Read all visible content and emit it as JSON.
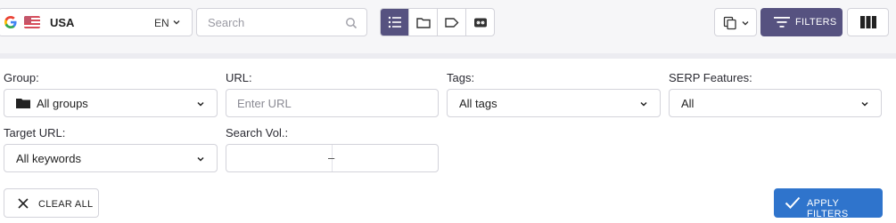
{
  "topbar": {
    "country": "USA",
    "language": "EN",
    "search_placeholder": "Search",
    "view_icons": [
      "list-icon",
      "folder-icon",
      "tag-icon",
      "link-icon"
    ],
    "filters_label": "FILTERS",
    "accent_color": "#565280"
  },
  "filters": {
    "group_label": "Group:",
    "group_value": "All groups",
    "url_label": "URL:",
    "url_placeholder": "Enter URL",
    "tags_label": "Tags:",
    "tags_value": "All tags",
    "serp_label": "SERP Features:",
    "serp_value": "All",
    "target_url_label": "Target URL:",
    "target_url_value": "All keywords",
    "search_vol_label": "Search Vol.:",
    "search_vol_separator": "–"
  },
  "actions": {
    "clear_label": "CLEAR ALL",
    "apply_label": "APPLY FILTERS",
    "apply_color": "#2f74cc"
  }
}
